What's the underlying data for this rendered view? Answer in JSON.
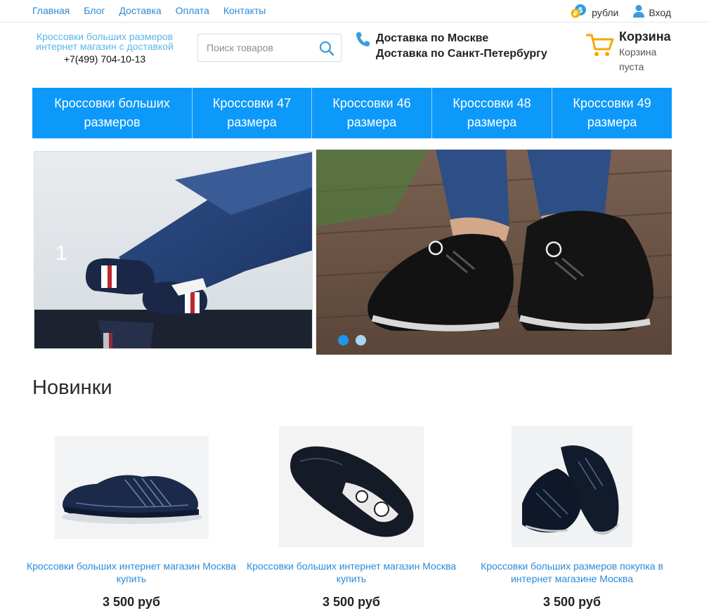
{
  "topnav": {
    "links": [
      "Главная",
      "Блог",
      "Доставка",
      "Оплата",
      "Контакты"
    ]
  },
  "topright": {
    "currency_label": "рубли",
    "login_label": "Вход"
  },
  "header": {
    "tagline": "Кроссовки больших размеров интернет магазин с доставкой",
    "phone": "+7(499) 704-10-13",
    "search_placeholder": "Поиск товаров",
    "delivery_moscow": "Доставка по Москве",
    "delivery_spb": "Доставка по Санкт-Петербургу",
    "cart_title": "Корзина",
    "cart_status": "Корзина пуста"
  },
  "categories": [
    "Кроссовки больших размеров",
    "Кроссовки 47 размера",
    "Кроссовки 46 размера",
    "Кроссовки 48 размера",
    "Кроссовки 49 размера"
  ],
  "slider": {
    "left_slide_number": "1",
    "dots_count": 2,
    "active_dot": 1
  },
  "new_arrivals": {
    "title": "Новинки",
    "products": [
      {
        "name": "Кроссовки больших интернет магазин Москва купить",
        "price": "3 500 руб"
      },
      {
        "name": "Кроссовки больших интернет магазин Москва купить",
        "price": "3 500 руб"
      },
      {
        "name": "Кроссовки больших размеров покупка в интернет магазине Москва",
        "price": "3 500 руб"
      }
    ]
  },
  "colors": {
    "accent": "#0d99f9",
    "link": "#2a8ad8",
    "tagline": "#59b6e8",
    "cart_icon": "#f5a800"
  },
  "icons": {
    "currency": "currency-exchange-icon",
    "login": "user-icon",
    "search": "search-icon",
    "phone": "phone-icon",
    "cart": "cart-icon"
  }
}
